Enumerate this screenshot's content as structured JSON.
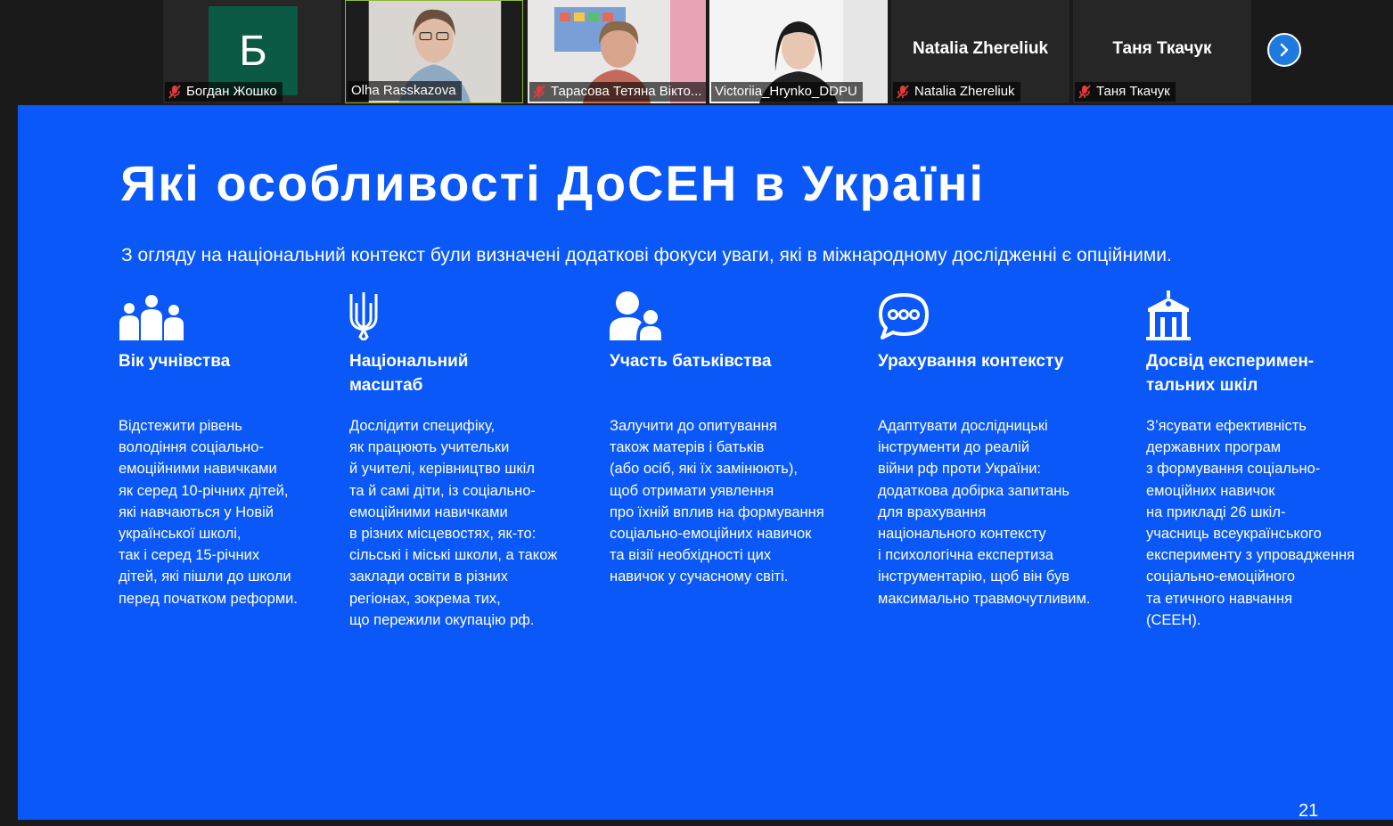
{
  "participants": [
    {
      "name": "Богдан Жошко",
      "avatar_letter": "Б",
      "muted": true,
      "video": false
    },
    {
      "name": "Olha Rasskazova",
      "muted": false,
      "video": true,
      "active": true
    },
    {
      "name": "Тарасова Тетяна Вікто...",
      "muted": true,
      "video": true
    },
    {
      "name": "Victoriia_Hrynko_DDPU",
      "muted": false,
      "video": true
    },
    {
      "name": "Natalia Zhereliuk",
      "display_name": "Natalia Zhereliuk",
      "muted": true,
      "video": false
    },
    {
      "name": "Таня Ткачук",
      "display_name": "Таня Ткачук",
      "muted": true,
      "video": false
    }
  ],
  "next_page_icon": "chevron-right-icon",
  "slide": {
    "title": "Які особливості ДоСЕН в Україні",
    "subtitle": "З огляду на національний контекст були визначені додаткові фокуси уваги, які в міжнародному дослідженні є опційними.",
    "page_number": "21",
    "background": "#0958f7",
    "columns": [
      {
        "icon": "people-group-icon",
        "heading": [
          "Вік учнівства"
        ],
        "lines": [
          "Відстежити рівень",
          "володіння соціально-",
          "емоційними навичками",
          "як серед 10-річних дітей,",
          "які навчаються у Новій",
          "української школі,",
          "так і серед 15-річних",
          "дітей, які пішли до школи",
          "перед початком реформи."
        ]
      },
      {
        "icon": "trident-icon",
        "heading": [
          "Національний",
          "масштаб"
        ],
        "lines": [
          "Дослідити специфіку,",
          "як працюють учительки",
          "й учителі, керівництво шкіл",
          "та й самі діти, із соціально-",
          "емоційними навичками",
          "в різних місцевостях, як-то:",
          "сільські і міські школи, а також",
          "заклади освіти в різних",
          "регіонах, зокрема тих,",
          "що пережили окупацію рф."
        ]
      },
      {
        "icon": "parent-child-icon",
        "heading": [
          "Участь батьківства"
        ],
        "lines": [
          "Залучити до опитування",
          "також матерів і батьків",
          "(або осіб, які їх замінюють),",
          "щоб отримати уявлення",
          "про їхній вплив на формування",
          "соціально-емоційних навичок",
          "та візії необхідності цих",
          "навичок у сучасному світі."
        ]
      },
      {
        "icon": "chat-bubble-icon",
        "heading": [
          "Урахування контексту"
        ],
        "lines": [
          "Адаптувати дослідницькі",
          "інструменти до реалій",
          "війни рф проти України:",
          "додаткова добірка запитань",
          "для врахування",
          "національного контексту",
          "і психологічна експертиза",
          "інструментарію, щоб він був",
          "максимально травмочутливим."
        ]
      },
      {
        "icon": "school-building-icon",
        "heading": [
          "Досвід експеримен-",
          "тальних шкіл"
        ],
        "lines": [
          "З’ясувати ефективність",
          "державних програм",
          "з формування соціально-",
          "емоційних навичок",
          "на прикладі 26 шкіл-",
          "учасниць всеукраїнського",
          "експерименту з упровадження",
          "соціально-емоційного",
          "та етичного навчання",
          "(СЕЕН)."
        ]
      }
    ]
  }
}
